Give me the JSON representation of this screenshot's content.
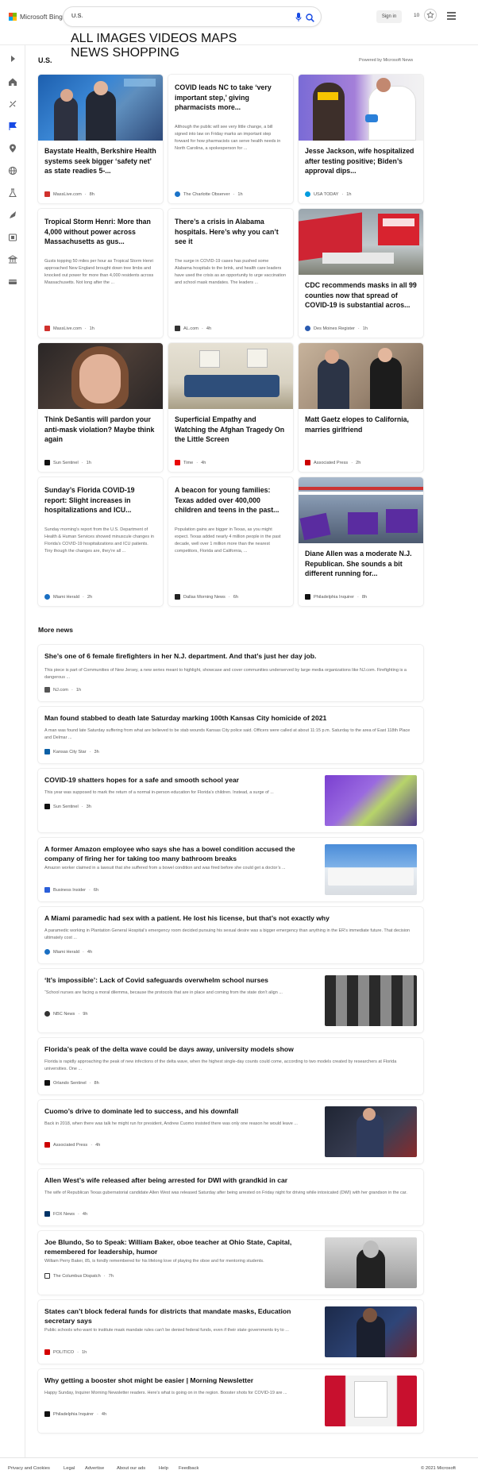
{
  "header": {
    "brand": "Microsoft Bing",
    "search_value": "U.S.",
    "signin": "Sign in",
    "points": "10",
    "nav": [
      "ALL",
      "IMAGES",
      "VIDEOS",
      "MAPS",
      "NEWS",
      "SHOPPING"
    ],
    "active_nav": "NEWS"
  },
  "section": {
    "title": "U.S.",
    "powered": "Powered by Microsoft News"
  },
  "cards": [
    {
      "headline": "Baystate Health, Berkshire Health systems seek bigger ‘safety net’ as state readies 5-...",
      "snippet": "",
      "source": "MassLive.com",
      "time": "8h"
    },
    {
      "headline": "COVID leads NC to take ‘very important step,’ giving pharmacists more...",
      "snippet": "Although the public will see very little change, a bill signed into law on Friday marks an important step forward for how pharmacists can serve health needs in North Carolina, a spokesperson for ...",
      "source": "The Charlotte Observer",
      "time": "1h"
    },
    {
      "headline": "Jesse Jackson, wife hospitalized after testing positive; Biden’s approval dips...",
      "snippet": "",
      "source": "USA TODAY",
      "time": "1h"
    },
    {
      "headline": "Tropical Storm Henri: More than 4,000 without power across Massachusetts as gus...",
      "snippet": "Gusts topping 50 miles per hour as Tropical Storm Henri approached New England brought down tree limbs and knocked out power for more than 4,000 residents across Massachusetts. Not long after the ...",
      "source": "MassLive.com",
      "time": "1h"
    },
    {
      "headline": "There’s a crisis in Alabama hospitals. Here’s why you can’t see it",
      "snippet": "The surge in COVID-19 cases has pushed some Alabama hospitals to the brink, and health care leaders have used the crisis as an opportunity to urge vaccination and school mask mandates. The leaders ...",
      "source": "AL.com",
      "time": "4h"
    },
    {
      "headline": "CDC recommends masks in all 99 counties now that spread of COVID-19 is substantial acros...",
      "snippet": "",
      "source": "Des Moines Register",
      "time": "1h"
    },
    {
      "headline": "Think DeSantis will pardon your anti-mask violation? Maybe think again",
      "snippet": "",
      "source": "Sun Sentinel",
      "time": "1h"
    },
    {
      "headline": "Superficial Empathy and Watching the Afghan Tragedy On the Little Screen",
      "snippet": "",
      "source": "Time",
      "time": "4h"
    },
    {
      "headline": "Matt Gaetz elopes to California, marries girlfriend",
      "snippet": "",
      "source": "Associated Press",
      "time": "2h"
    },
    {
      "headline": "Sunday’s Florida COVID-19 report: Slight increases in hospitalizations and ICU...",
      "snippet": "Sunday morning’s report from the U.S. Department of Health & Human Services showed minuscule changes in Florida’s COVID-19 hospitalizations and ICU patients. Tiny though the changes are, they’re all ...",
      "source": "Miami Herald",
      "time": "2h"
    },
    {
      "headline": "A beacon for young families: Texas added over 400,000 children and teens in the past...",
      "snippet": "Population gains are bigger in Texas, as you might expect. Texas added nearly 4 million people in the past decade, well over 1 million more than the nearest competitors, Florida and California, ...",
      "source": "Dallas Morning News",
      "time": "6h"
    },
    {
      "headline": "Diane Allen was a moderate N.J. Republican. She sounds a bit different running for...",
      "snippet": "",
      "source": "Philadelphia Inquirer",
      "time": "8h"
    }
  ],
  "more_news_title": "More news",
  "more_news": [
    {
      "headline": "She’s one of 6 female firefighters in her N.J. department. And that’s just her day job.",
      "snippet": "This piece is part of Communities of New Jersey, a new series meant to highlight, showcase and cover communities underserved by large media organizations like NJ.com. Firefighting is a dangerous ...",
      "source": "NJ.com",
      "time": "1h"
    },
    {
      "headline": "Man found stabbed to death late Saturday marking 100th Kansas City homicide of 2021",
      "snippet": "A man was found late Saturday suffering from what are believed to be stab wounds Kansas City police said. Officers were called at about 11:15 p.m. Saturday to the area of East 118th Place and Delmar ...",
      "source": "Kansas City Star",
      "time": "3h"
    },
    {
      "headline": "COVID-19 shatters hopes for a safe and smooth school year",
      "snippet": "This year was supposed to mark the return of a normal in-person education for Florida’s children. Instead, a surge of ...",
      "source": "Sun Sentinel",
      "time": "3h"
    },
    {
      "headline": "A former Amazon employee who says she has a bowel condition accused the company of firing her for taking too many bathroom breaks",
      "snippet": "Amazon worker claimed in a lawsuit that she suffered from a bowel condition and was fired before she could get a doctor’s ...",
      "source": "Business Insider",
      "time": "6h"
    },
    {
      "headline": "A Miami paramedic had sex with a patient. He lost his license, but that’s not exactly why",
      "snippet": "A paramedic working in Plantation General Hospital’s emergency room decided pursuing his sexual desire was a bigger emergency than anything in the ER’s immediate future. That decision ultimately cost ...",
      "source": "Miami Herald",
      "time": "4h"
    },
    {
      "headline": "‘It’s impossible’: Lack of Covid safeguards overwhelm school nurses",
      "snippet": "“School nurses are facing a moral dilemma, because the protocols that are in place and coming from the state don’t align ...",
      "source": "NBC News",
      "time": "9h"
    },
    {
      "headline": "Florida’s peak of the delta wave could be days away, university models show",
      "snippet": "Florida is rapidly approaching the peak of new infections of the delta wave, when the highest single-day counts could come, according to two models created by researchers at Florida universities. One ...",
      "source": "Orlando Sentinel",
      "time": "8h"
    },
    {
      "headline": "Cuomo’s drive to dominate led to success, and his downfall",
      "snippet": "Back in 2018, when there was talk he might run for president, Andrew Cuomo insisted there was only one reason he would leave ...",
      "source": "Associated Press",
      "time": "4h"
    },
    {
      "headline": "Allen West’s wife released after being arrested for DWI with grandkid in car",
      "snippet": "The wife of Republican Texas gubernatorial candidate Allen West was released Saturday after being arrested on Friday night for driving while intoxicated (DWI) with her grandson in the car.",
      "source": "FOX News",
      "time": "4h"
    },
    {
      "headline": "Joe Blundo, So to Speak: William Baker, oboe teacher at Ohio State, Capital, remembered for leadership, humor",
      "snippet": "William Perry Baker, 85, is fondly remembered for his lifelong love of playing the oboe and for mentoring students.",
      "source": "The Columbus Dispatch",
      "time": "7h"
    },
    {
      "headline": "States can’t block federal funds for districts that mandate masks, Education secretary says",
      "snippet": "Public schools who want to institute mask mandate rules can’t be denied federal funds, even if their state governments try to ...",
      "source": "POLITICO",
      "time": "1h"
    },
    {
      "headline": "Why getting a booster shot might be easier | Morning Newsletter",
      "snippet": "Happy Sunday, Inquirer Morning Newsletter readers. Here’s what is going on in the region. Booster shots for COVID-19 are ...",
      "source": "Philadelphia Inquirer",
      "time": "4h"
    }
  ],
  "footer": {
    "links": [
      "Privacy and Cookies",
      "Legal",
      "Advertise",
      "About our ads",
      "Help",
      "Feedback"
    ],
    "copyright": "© 2021 Microsoft"
  },
  "colors": {
    "accent": "#174ae4",
    "brand_red": "#f25022",
    "brand_green": "#7fba00",
    "brand_blue": "#00a4ef",
    "brand_yellow": "#ffb900"
  },
  "icons": [
    "search-icon",
    "microphone-icon",
    "rewards-icon",
    "hamburger-menu-icon",
    "expand-rail-icon",
    "home-icon",
    "sports-icon",
    "flag-icon",
    "location-icon",
    "globe-icon",
    "science-icon",
    "rocket-icon",
    "entertainment-icon",
    "money-icon",
    "layout-icon"
  ]
}
